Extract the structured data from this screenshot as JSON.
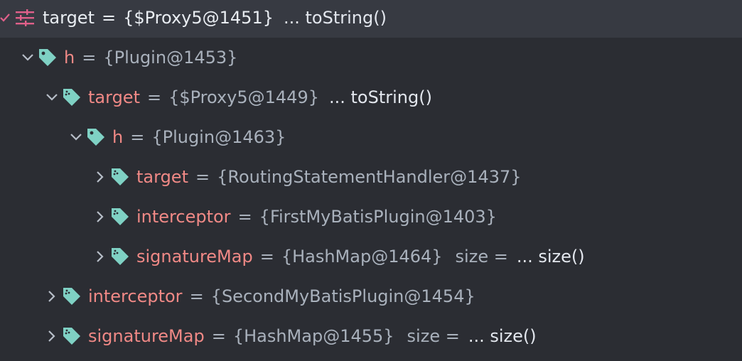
{
  "root": {
    "name": "target",
    "eq": "=",
    "value": "{$Proxy5@1451}",
    "ellipsis": "... toString()"
  },
  "rows": [
    {
      "name": "h",
      "eq": "=",
      "value": "{Plugin@1453}",
      "expanded": true
    },
    {
      "name": "target",
      "eq": "=",
      "value": "{$Proxy5@1449}",
      "ellipsis": "... toString()",
      "expanded": true
    },
    {
      "name": "h",
      "eq": "=",
      "value": "{Plugin@1463}",
      "expanded": true
    },
    {
      "name": "target",
      "eq": "=",
      "value": "{RoutingStatementHandler@1437}",
      "expanded": false
    },
    {
      "name": "interceptor",
      "eq": "=",
      "value": "{FirstMyBatisPlugin@1403}",
      "expanded": false
    },
    {
      "name": "signatureMap",
      "eq": "=",
      "value": "{HashMap@1464}",
      "size_label": "size =",
      "ellipsis": "... size()",
      "expanded": false
    },
    {
      "name": "interceptor",
      "eq": "=",
      "value": "{SecondMyBatisPlugin@1454}",
      "expanded": false
    },
    {
      "name": "signatureMap",
      "eq": "=",
      "value": "{HashMap@1455}",
      "size_label": "size =",
      "ellipsis": "... size()",
      "expanded": false
    }
  ],
  "colors": {
    "background": "#2b2d33",
    "selected_row": "#373a42",
    "field_name": "#f08986",
    "value_text": "#a9b1bc",
    "tag_icon": "#7fd1c4",
    "watch_icon": "#e0608a"
  },
  "icons": {
    "root": "watch-settings-icon",
    "field": "field-tag-icon",
    "expand": "chevron-down-icon",
    "collapse": "chevron-right-icon"
  }
}
